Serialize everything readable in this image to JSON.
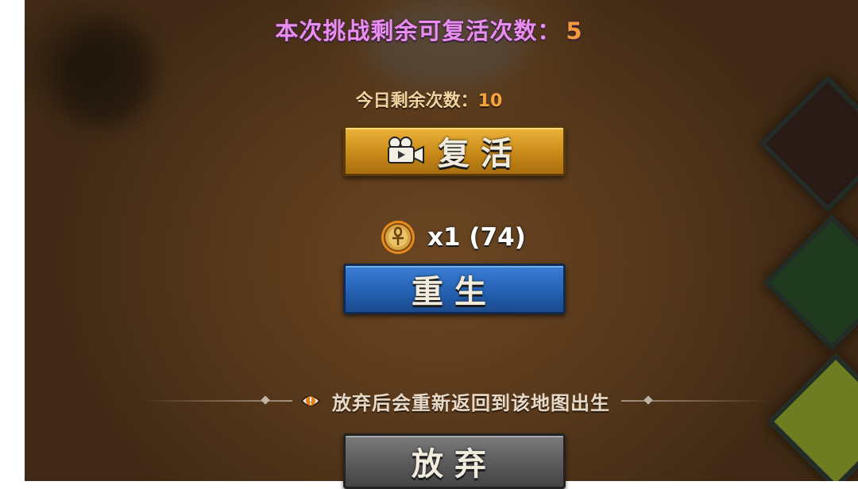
{
  "revive_panel": {
    "title_label": "本次挑战剩余可复活次数：",
    "title_count": "5",
    "daily_label": "今日剩余次数：",
    "daily_count": "10",
    "revive_button": {
      "label": "复活",
      "icon": "video-camera-icon"
    },
    "rebirth_cost": {
      "icon": "ankh-coin-icon",
      "text": "x1 (74)"
    },
    "rebirth_button": {
      "label": "重生"
    },
    "notice": {
      "icon": "warning-icon",
      "text": "放弃后会重新返回到该地图出生"
    },
    "give_up_button": {
      "label": "放弃"
    }
  },
  "colors": {
    "title": "#e98ef0",
    "count_orange": "#f39a3c",
    "daily_text": "#f0d3a0",
    "revive_gold": "#c98a19",
    "rebirth_blue": "#2561b4",
    "give_up_gray": "#5a5a5a"
  }
}
